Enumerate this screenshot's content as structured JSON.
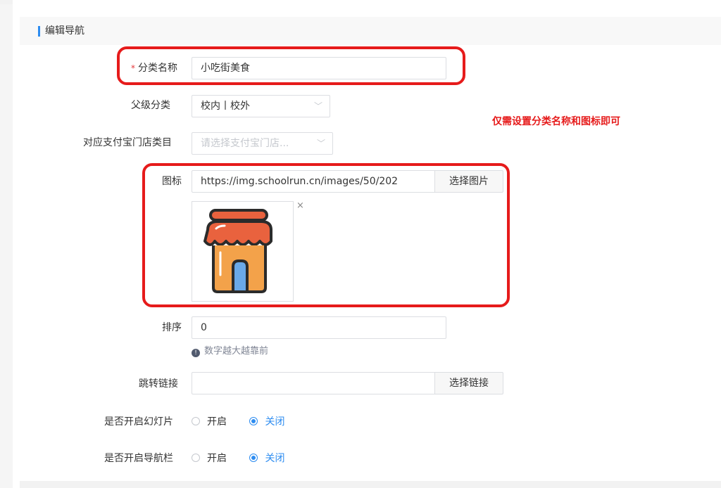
{
  "section": {
    "title": "编辑导航"
  },
  "form": {
    "category_name": {
      "label": "分类名称",
      "required_mark": "*",
      "value": "小吃街美食"
    },
    "parent_category": {
      "label": "父级分类",
      "value": "校内丨校外",
      "arrow": "chevron-down-icon"
    },
    "alipay_category": {
      "label": "对应支付宝门店类目",
      "placeholder": "请选择支付宝门店...",
      "arrow": "chevron-down-icon"
    },
    "icon": {
      "label": "图标",
      "value": "https://img.schoolrun.cn/images/50/202",
      "button": "选择图片",
      "remove": "×"
    },
    "sort": {
      "label": "排序",
      "value": "0",
      "hint": "数字越大越靠前",
      "hint_icon": "!"
    },
    "jump_link": {
      "label": "跳转链接",
      "value": "",
      "button": "选择链接"
    },
    "slideshow": {
      "label": "是否开启幻灯片",
      "options": [
        "开启",
        "关闭"
      ],
      "selected": "关闭"
    },
    "navbar": {
      "label": "是否开启导航栏",
      "options": [
        "开启",
        "关闭"
      ],
      "selected": "关闭"
    }
  },
  "annotation": {
    "note": "仅需设置分类名称和图标即可",
    "highlight_color": "#e61b1b"
  },
  "colors": {
    "accent": "#2d8cf0",
    "annotation": "#e61b1b"
  }
}
